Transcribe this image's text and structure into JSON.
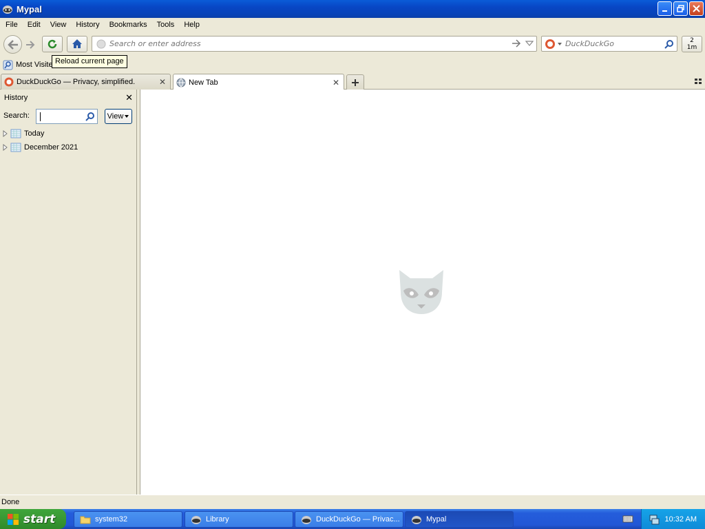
{
  "window": {
    "title": "Mypal"
  },
  "menu": [
    {
      "label": "File"
    },
    {
      "label": "Edit"
    },
    {
      "label": "View"
    },
    {
      "label": "History"
    },
    {
      "label": "Bookmarks"
    },
    {
      "label": "Tools"
    },
    {
      "label": "Help"
    }
  ],
  "navbar": {
    "url_placeholder": "Search or enter address",
    "search_placeholder": "DuckDuckGo",
    "zoom_label_top": "2",
    "zoom_label_bottom": "1m"
  },
  "bookmarks": {
    "most_visited": "Most Visited"
  },
  "tooltip": {
    "text": "Reload current page"
  },
  "tabs": [
    {
      "label": "DuckDuckGo — Privacy, simplified.",
      "active": false
    },
    {
      "label": "New Tab",
      "active": true
    }
  ],
  "sidebar": {
    "title": "History",
    "search_label": "Search:",
    "view_label": "View",
    "items": [
      {
        "label": "Today"
      },
      {
        "label": "December 2021"
      }
    ]
  },
  "status": {
    "text": "Done"
  },
  "taskbar": {
    "start_label": "start",
    "tasks": [
      {
        "label": "system32",
        "icon": "folder-icon"
      },
      {
        "label": "Library",
        "icon": "mypal-icon"
      },
      {
        "label": "DuckDuckGo — Privac...",
        "icon": "mypal-icon"
      },
      {
        "label": "Mypal",
        "icon": "mypal-icon",
        "active": true
      }
    ],
    "clock": "10:32 AM"
  },
  "colors": {
    "titlebar": "#0846c4",
    "taskbar": "#245ddb",
    "start": "#3a9a35",
    "tray": "#0f8bd8"
  }
}
